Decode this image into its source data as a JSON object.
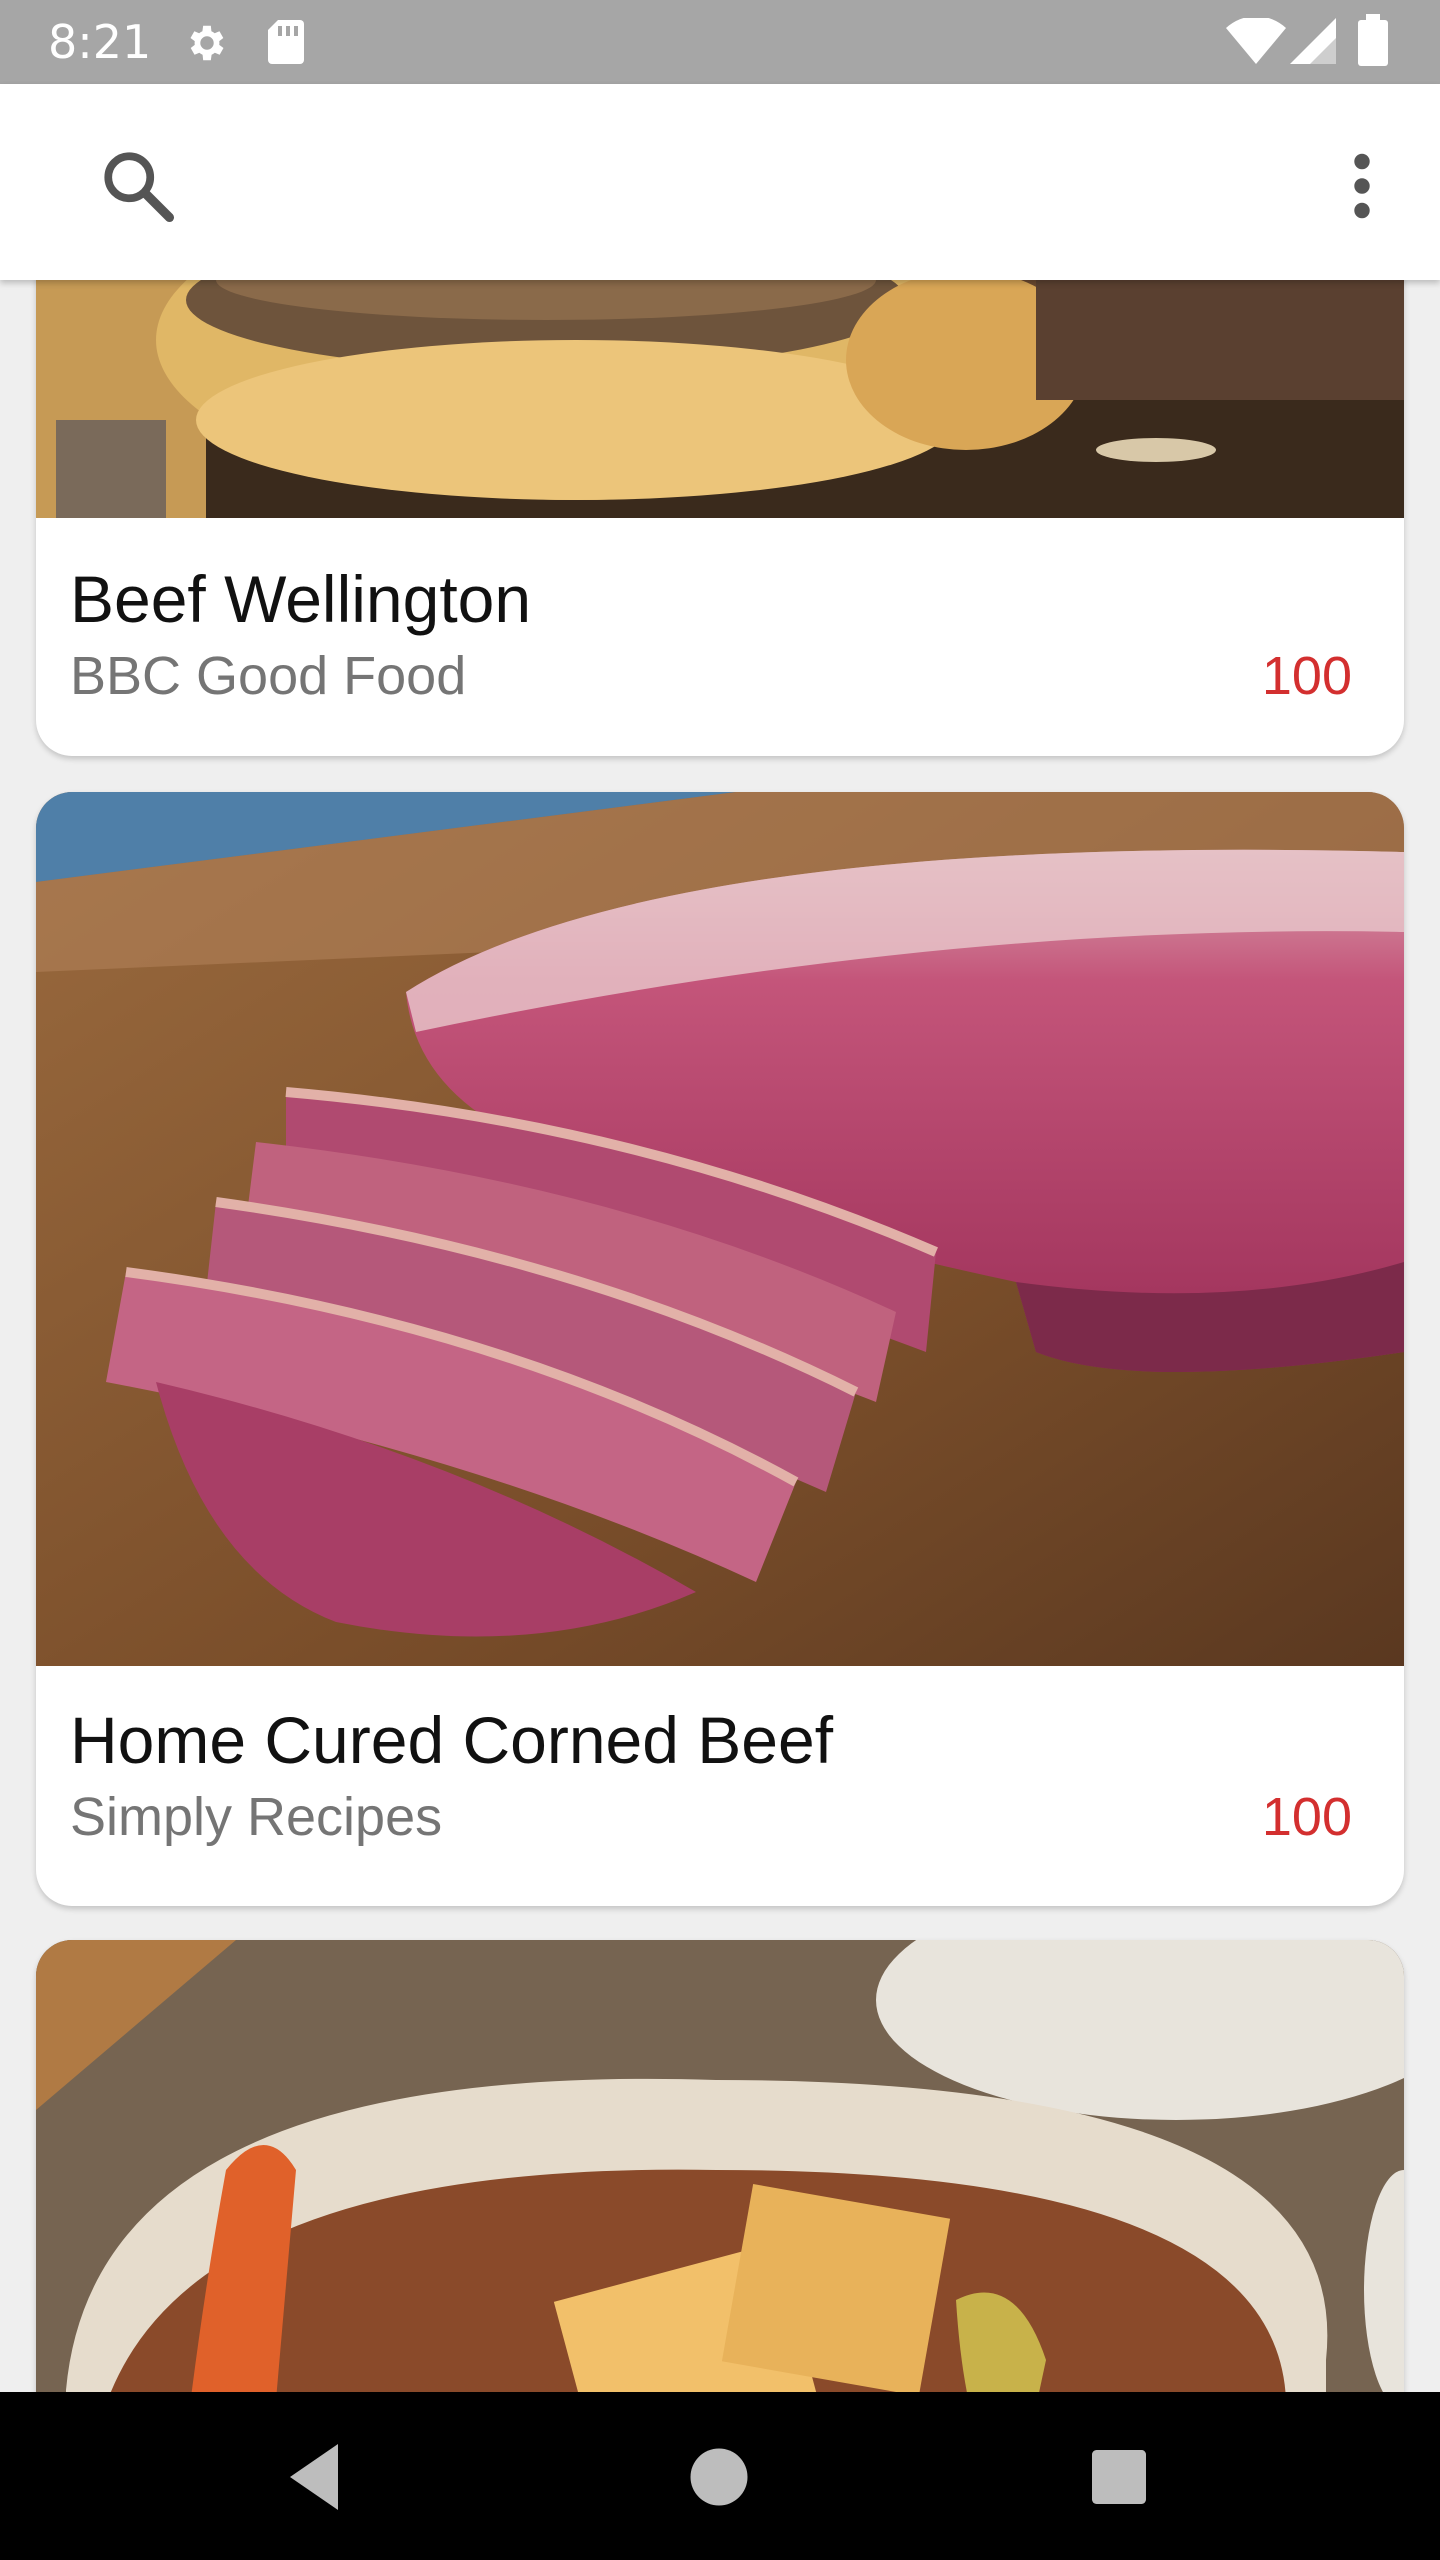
{
  "status_bar": {
    "time": "8:21",
    "icons": [
      "settings-icon",
      "sd-card-icon",
      "wifi-icon",
      "signal-icon",
      "battery-icon"
    ]
  },
  "app_bar": {
    "icons": [
      "search-icon",
      "more-vertical-icon"
    ]
  },
  "recipes": [
    {
      "title": "Beef Wellington",
      "source": "BBC Good Food",
      "score": "100",
      "image": "beef-wellington-photo"
    },
    {
      "title": "Home Cured Corned Beef",
      "source": "Simply Recipes",
      "score": "100",
      "image": "corned-beef-photo"
    },
    {
      "title": "",
      "source": "",
      "score": "",
      "image": "beef-stew-photo"
    }
  ],
  "nav_bar": {
    "icons": [
      "back-icon",
      "home-icon",
      "recents-icon"
    ]
  },
  "colors": {
    "status_bar": "#a6a6a6",
    "app_bar": "#ffffff",
    "background": "#efefef",
    "score": "#d32f2f",
    "source_text": "#757575",
    "nav_bar": "#000000"
  }
}
